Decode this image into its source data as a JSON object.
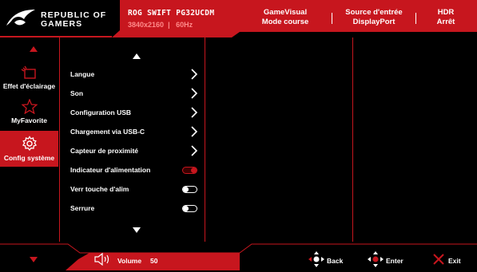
{
  "colors": {
    "accent": "#c7161e",
    "background": "#000000",
    "text": "#ffffff"
  },
  "header": {
    "brand_line1": "REPUBLIC OF",
    "brand_line2": "GAMERS",
    "model": "ROG SWIFT PG32UCDM",
    "resolution": "3840x2160",
    "refresh": "60Hz",
    "status": [
      {
        "line1": "GameVisual",
        "line2": "Mode course"
      },
      {
        "line1": "Source d'entrée",
        "line2": "DisplayPort"
      },
      {
        "line1": "HDR",
        "line2": "Arrêt"
      }
    ]
  },
  "sidebar": {
    "items": [
      {
        "label": "Effet d'éclairage",
        "icon": "lighting-effect-icon",
        "active": false
      },
      {
        "label": "MyFavorite",
        "icon": "star-icon",
        "active": false
      },
      {
        "label": "Config système",
        "icon": "gear-icon",
        "active": true
      }
    ]
  },
  "menu": {
    "items": [
      {
        "label": "Langue",
        "control": "chevron"
      },
      {
        "label": "Son",
        "control": "chevron"
      },
      {
        "label": "Configuration USB",
        "control": "chevron"
      },
      {
        "label": "Chargement via USB-C",
        "control": "chevron"
      },
      {
        "label": "Capteur de proximité",
        "control": "chevron"
      },
      {
        "label": "Indicateur d'alimentation",
        "control": "toggle",
        "state": "on"
      },
      {
        "label": "Verr touche d'alim",
        "control": "toggle",
        "state": "off"
      },
      {
        "label": "Serrure",
        "control": "toggle",
        "state": "off"
      }
    ]
  },
  "footer": {
    "volume_label": "Volume",
    "volume_value": "50",
    "back_label": "Back",
    "enter_label": "Enter",
    "exit_label": "Exit"
  }
}
